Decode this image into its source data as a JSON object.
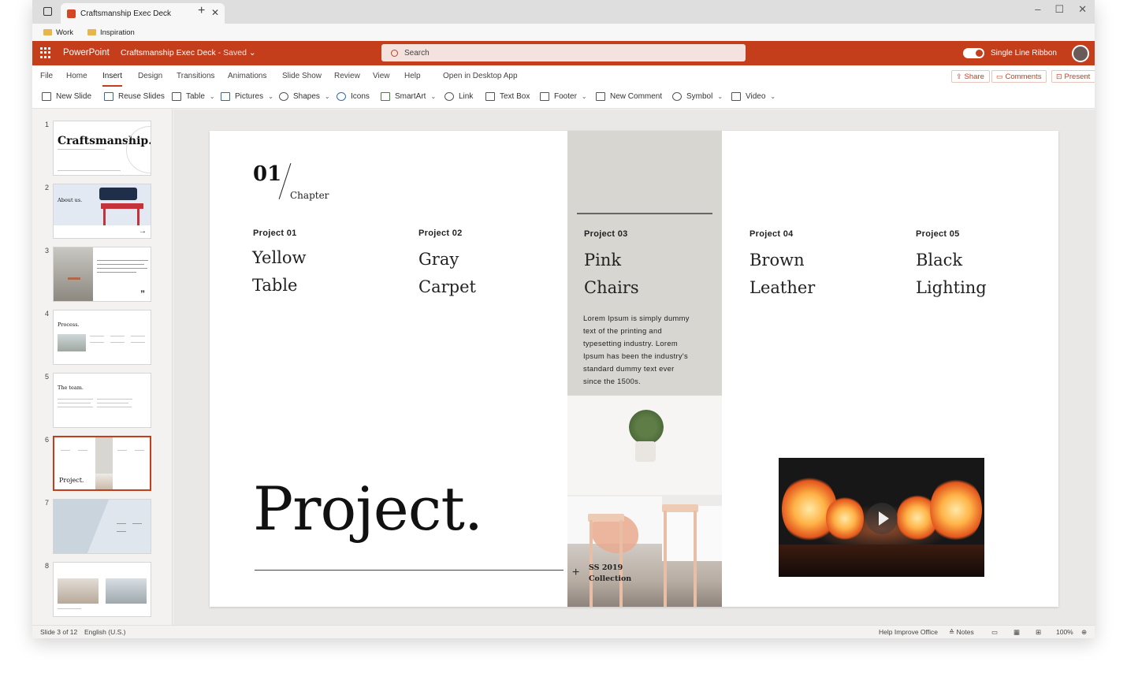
{
  "browser": {
    "tab_title": "Craftsmanship Exec Deck",
    "bookmarks": [
      "Work",
      "Inspiration"
    ]
  },
  "app": {
    "name": "PowerPoint",
    "doc_title": "Craftsmanship Exec Deck",
    "save_status": "- Saved",
    "search_placeholder": "Search",
    "ribbon_toggle_label": "Single Line Ribbon",
    "accent_color": "#c43e1c"
  },
  "menu": {
    "items": [
      "File",
      "Home",
      "Insert",
      "Design",
      "Transitions",
      "Animations",
      "Slide Show",
      "Review",
      "View",
      "Help",
      "Open in Desktop App"
    ],
    "active": "Insert",
    "share": "Share",
    "comments": "Comments",
    "present": "Present"
  },
  "toolbar": {
    "new_slide": "New Slide",
    "reuse_slides": "Reuse Slides",
    "table": "Table",
    "pictures": "Pictures",
    "shapes": "Shapes",
    "icons": "Icons",
    "smartart": "SmartArt",
    "link": "Link",
    "text_box": "Text Box",
    "footer": "Footer",
    "new_comment": "New Comment",
    "symbol": "Symbol",
    "video": "Video"
  },
  "thumbnails": {
    "numbers": [
      "1",
      "2",
      "3",
      "4",
      "5",
      "6",
      "7",
      "8"
    ],
    "titles": [
      "Craftsmanship.",
      "About us.",
      "",
      "Process.",
      "The team.",
      "Project.",
      "",
      ""
    ],
    "selected": 6
  },
  "slide": {
    "chapter_number": "01",
    "chapter_word": "Chapter",
    "projects": [
      {
        "label": "Project 01",
        "line1": "Yellow",
        "line2": "Table"
      },
      {
        "label": "Project 02",
        "line1": "Gray",
        "line2": "Carpet"
      },
      {
        "label": "Project 03",
        "line1": "Pink",
        "line2": "Chairs"
      },
      {
        "label": "Project 04",
        "line1": "Brown",
        "line2": "Leather"
      },
      {
        "label": "Project 05",
        "line1": "Black",
        "line2": "Lighting"
      }
    ],
    "lorem": "Lorem Ipsum is simply dummy text of the printing and typesetting industry. Lorem Ipsum has been the industry's standard dummy text ever since the 1500s.",
    "collection_line1": "SS 2019",
    "collection_line2": "Collection",
    "big_title": "Project."
  },
  "status": {
    "slide_counter": "Slide 3 of 12",
    "language": "English (U.S.)",
    "help": "Help Improve Office",
    "notes": "Notes",
    "zoom": "100%"
  }
}
